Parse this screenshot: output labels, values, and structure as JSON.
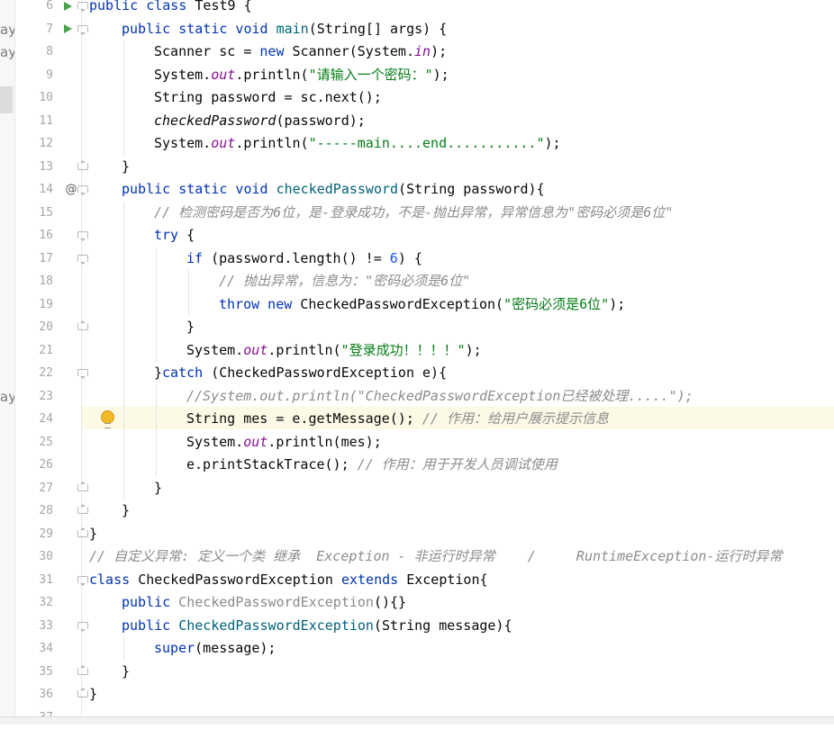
{
  "editor": {
    "current_line": 24,
    "gutter_markers": {
      "run_lines": [
        6,
        7
      ],
      "override_line": 14,
      "bulb_line": 24
    },
    "gutter_symbols": {
      "override": "@"
    },
    "left_panel_fragments": [
      {
        "text": "ay",
        "line": 7
      },
      {
        "text": "ay",
        "line": 8
      },
      {
        "text": "ay",
        "line": 23
      }
    ],
    "lines": [
      {
        "n": 6,
        "indent": 0,
        "fold": "open",
        "tokens": [
          {
            "t": "public class ",
            "c": "kw"
          },
          {
            "t": "Test9 {",
            "c": ""
          }
        ]
      },
      {
        "n": 7,
        "indent": 1,
        "fold": "open",
        "tokens": [
          {
            "t": "public static void ",
            "c": "kw"
          },
          {
            "t": "main",
            "c": "fn"
          },
          {
            "t": "(String[] args) {",
            "c": ""
          }
        ]
      },
      {
        "n": 8,
        "indent": 2,
        "tokens": [
          {
            "t": "Scanner sc = ",
            "c": ""
          },
          {
            "t": "new ",
            "c": "kw"
          },
          {
            "t": "Scanner(System.",
            "c": ""
          },
          {
            "t": "in",
            "c": "fi"
          },
          {
            "t": ");",
            "c": ""
          }
        ]
      },
      {
        "n": 9,
        "indent": 2,
        "tokens": [
          {
            "t": "System.",
            "c": ""
          },
          {
            "t": "out",
            "c": "fi"
          },
          {
            "t": ".println(",
            "c": ""
          },
          {
            "t": "\"请输入一个密码：\"",
            "c": "st"
          },
          {
            "t": ");",
            "c": ""
          }
        ]
      },
      {
        "n": 10,
        "indent": 2,
        "tokens": [
          {
            "t": "String password = sc.next();",
            "c": ""
          }
        ]
      },
      {
        "n": 11,
        "indent": 2,
        "tokens": [
          {
            "t": "checkedPassword",
            "c": "it"
          },
          {
            "t": "(password);",
            "c": ""
          }
        ]
      },
      {
        "n": 12,
        "indent": 2,
        "tokens": [
          {
            "t": "System.",
            "c": ""
          },
          {
            "t": "out",
            "c": "fi"
          },
          {
            "t": ".println(",
            "c": ""
          },
          {
            "t": "\"-----main....end...........\"",
            "c": "st"
          },
          {
            "t": ");",
            "c": ""
          }
        ]
      },
      {
        "n": 13,
        "indent": 1,
        "fold": "close",
        "tokens": [
          {
            "t": "}",
            "c": ""
          }
        ]
      },
      {
        "n": 14,
        "indent": 1,
        "fold": "open",
        "tokens": [
          {
            "t": "public static void ",
            "c": "kw"
          },
          {
            "t": "checkedPassword",
            "c": "fn"
          },
          {
            "t": "(String password){",
            "c": ""
          }
        ]
      },
      {
        "n": 15,
        "indent": 2,
        "tokens": [
          {
            "t": "// 检测密码是否为6位，是-登录成功，不是-抛出异常，异常信息为\"密码必须是6位\"",
            "c": "cm"
          }
        ]
      },
      {
        "n": 16,
        "indent": 2,
        "fold": "open",
        "tokens": [
          {
            "t": "try ",
            "c": "kw"
          },
          {
            "t": "{",
            "c": ""
          }
        ]
      },
      {
        "n": 17,
        "indent": 3,
        "fold": "open",
        "tokens": [
          {
            "t": "if ",
            "c": "kw"
          },
          {
            "t": "(password.length() != ",
            "c": ""
          },
          {
            "t": "6",
            "c": "nm"
          },
          {
            "t": ") {",
            "c": ""
          }
        ]
      },
      {
        "n": 18,
        "indent": 4,
        "tokens": [
          {
            "t": "// 抛出异常，信息为：\"密码必须是6位\"",
            "c": "cm"
          }
        ]
      },
      {
        "n": 19,
        "indent": 4,
        "tokens": [
          {
            "t": "throw new ",
            "c": "kw"
          },
          {
            "t": "CheckedPasswordException(",
            "c": ""
          },
          {
            "t": "\"密码必须是6位\"",
            "c": "st"
          },
          {
            "t": ");",
            "c": ""
          }
        ]
      },
      {
        "n": 20,
        "indent": 3,
        "fold": "close",
        "tokens": [
          {
            "t": "}",
            "c": ""
          }
        ]
      },
      {
        "n": 21,
        "indent": 3,
        "tokens": [
          {
            "t": "System.",
            "c": ""
          },
          {
            "t": "out",
            "c": "fi"
          },
          {
            "t": ".println(",
            "c": ""
          },
          {
            "t": "\"登录成功！！！！\"",
            "c": "st"
          },
          {
            "t": ");",
            "c": ""
          }
        ]
      },
      {
        "n": 22,
        "indent": 2,
        "fold": "open",
        "tokens": [
          {
            "t": "}",
            "c": ""
          },
          {
            "t": "catch ",
            "c": "kw"
          },
          {
            "t": "(CheckedPasswordException e){",
            "c": ""
          }
        ]
      },
      {
        "n": 23,
        "indent": 3,
        "tokens": [
          {
            "t": "//System.out.println(\"CheckedPasswordException已经被处理.....\");",
            "c": "cm"
          }
        ]
      },
      {
        "n": 24,
        "indent": 3,
        "tokens": [
          {
            "t": "String mes = e.getMessage(); ",
            "c": ""
          },
          {
            "t": "// 作用：给用户展示提示信息",
            "c": "cm"
          }
        ]
      },
      {
        "n": 25,
        "indent": 3,
        "tokens": [
          {
            "t": "System.",
            "c": ""
          },
          {
            "t": "out",
            "c": "fi"
          },
          {
            "t": ".println(mes);",
            "c": ""
          }
        ]
      },
      {
        "n": 26,
        "indent": 3,
        "tokens": [
          {
            "t": "e.printStackTrace(); ",
            "c": ""
          },
          {
            "t": "// 作用：用于开发人员调试使用",
            "c": "cm"
          }
        ]
      },
      {
        "n": 27,
        "indent": 2,
        "fold": "close",
        "tokens": [
          {
            "t": "}",
            "c": ""
          }
        ]
      },
      {
        "n": 28,
        "indent": 1,
        "fold": "close",
        "tokens": [
          {
            "t": "}",
            "c": ""
          }
        ]
      },
      {
        "n": 29,
        "indent": 0,
        "fold": "close",
        "tokens": [
          {
            "t": "}",
            "c": ""
          }
        ]
      },
      {
        "n": 30,
        "indent": 0,
        "tokens": [
          {
            "t": "// 自定义异常: 定义一个类 继承  Exception - 非运行时异常    /     RuntimeException-运行时异常",
            "c": "cm"
          }
        ]
      },
      {
        "n": 31,
        "indent": 0,
        "fold": "open",
        "tokens": [
          {
            "t": "class ",
            "c": "kw"
          },
          {
            "t": "CheckedPasswordException ",
            "c": ""
          },
          {
            "t": "extends ",
            "c": "kw"
          },
          {
            "t": "Exception{",
            "c": ""
          }
        ]
      },
      {
        "n": 32,
        "indent": 1,
        "tokens": [
          {
            "t": "public ",
            "c": "kw"
          },
          {
            "t": "CheckedPasswordException",
            "c": "un"
          },
          {
            "t": "(){}",
            "c": ""
          }
        ]
      },
      {
        "n": 33,
        "indent": 1,
        "fold": "open",
        "tokens": [
          {
            "t": "public ",
            "c": "kw"
          },
          {
            "t": "CheckedPasswordException",
            "c": "fn"
          },
          {
            "t": "(String message){",
            "c": ""
          }
        ]
      },
      {
        "n": 34,
        "indent": 2,
        "tokens": [
          {
            "t": "super",
            "c": "kw"
          },
          {
            "t": "(message);",
            "c": ""
          }
        ]
      },
      {
        "n": 35,
        "indent": 1,
        "fold": "close",
        "tokens": [
          {
            "t": "}",
            "c": ""
          }
        ]
      },
      {
        "n": 36,
        "indent": 0,
        "fold": "close",
        "tokens": [
          {
            "t": "}",
            "c": ""
          }
        ]
      },
      {
        "n": 37,
        "indent": 0,
        "tokens": []
      }
    ]
  }
}
